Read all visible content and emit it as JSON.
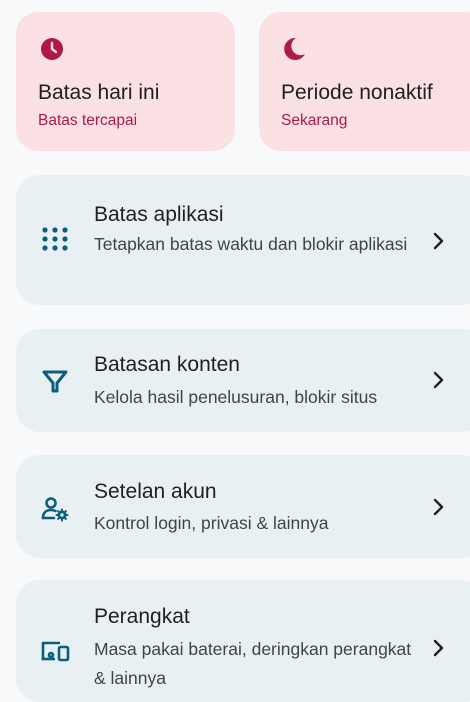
{
  "status_cards": [
    {
      "icon": "clock-icon",
      "title": "Batas hari ini",
      "subtitle": "Batas tercapai"
    },
    {
      "icon": "moon-icon",
      "title": "Periode nonaktif",
      "subtitle": "Sekarang"
    }
  ],
  "menu": [
    {
      "icon": "apps-grid-icon",
      "title": "Batas aplikasi",
      "description": "Tetapkan batas waktu dan blokir aplikasi"
    },
    {
      "icon": "filter-icon",
      "title": "Batasan konten",
      "description": "Kelola hasil penelusuran, blokir situs"
    },
    {
      "icon": "account-settings-icon",
      "title": "Setelan akun",
      "description": "Kontrol login, privasi & lainnya"
    },
    {
      "icon": "devices-icon",
      "title": "Perangkat",
      "description": "Masa pakai baterai, deringkan perangkat & lainnya"
    }
  ],
  "colors": {
    "accent_red": "#b0184a",
    "card_pink": "#fbe0e4",
    "row_bg": "#e8f0f4",
    "icon_teal": "#0b5f7c"
  }
}
